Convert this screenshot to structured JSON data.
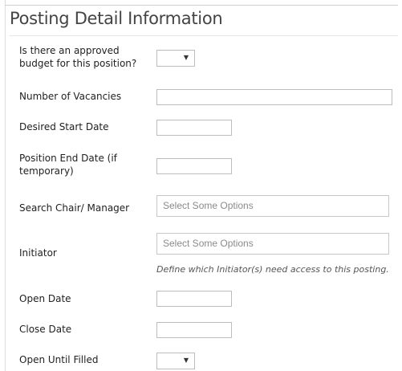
{
  "heading": "Posting Detail Information",
  "fields": {
    "approved_budget": {
      "label": "Is there an approved budget for this position?"
    },
    "vacancies": {
      "label": "Number of Vacancies",
      "value": ""
    },
    "desired_start": {
      "label": "Desired Start Date",
      "value": ""
    },
    "position_end": {
      "label": "Position End Date (if temporary)",
      "value": ""
    },
    "search_chair": {
      "label": "Search Chair/ Manager",
      "placeholder": "Select Some Options"
    },
    "initiator": {
      "label": "Initiator",
      "placeholder": "Select Some Options",
      "help": "Define which Initiator(s) need access to this posting."
    },
    "open_date": {
      "label": "Open Date",
      "value": ""
    },
    "close_date": {
      "label": "Close Date",
      "value": ""
    },
    "open_until_filled": {
      "label": "Open Until Filled"
    }
  },
  "icons": {
    "dropdown": "chevron-down-icon"
  }
}
